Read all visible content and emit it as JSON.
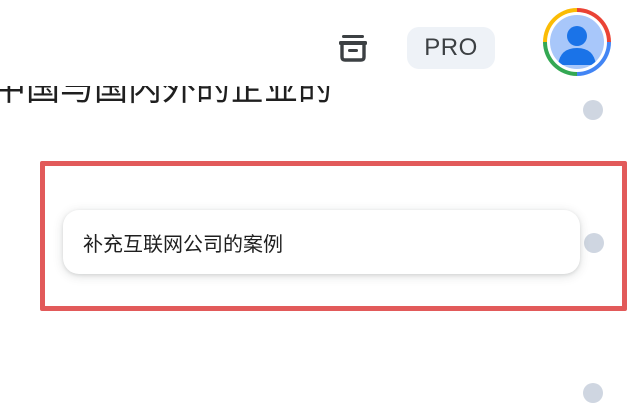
{
  "header": {
    "archive_icon": "archive-box-icon",
    "pro_badge": "PRO",
    "avatar_icon": "person-avatar-icon"
  },
  "conversation": {
    "previous_line": "中国与国内外的企业的",
    "suggestion": "补充互联网公司的案例"
  },
  "colors": {
    "highlight_border": "#e25a5a",
    "dot": "#cfd6e1",
    "pro_badge_bg": "#eef2f7",
    "avatar_bg": "#a8c7fa"
  }
}
